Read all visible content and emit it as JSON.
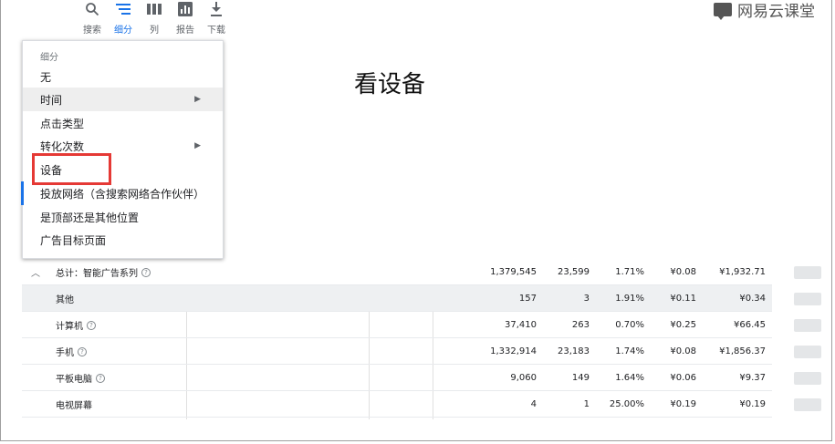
{
  "toolbar": {
    "items": [
      {
        "label": "搜索",
        "icon": "search-icon"
      },
      {
        "label": "细分",
        "icon": "segment-icon"
      },
      {
        "label": "列",
        "icon": "columns-icon"
      },
      {
        "label": "报告",
        "icon": "report-icon"
      },
      {
        "label": "下载",
        "icon": "download-icon"
      }
    ],
    "active_color": "#1a73e8"
  },
  "watermark": {
    "text": "网易云课堂"
  },
  "annotation": {
    "text": "看设备"
  },
  "menu": {
    "header": "细分",
    "items": [
      {
        "label": "无"
      },
      {
        "label": "时间",
        "has_submenu": true
      },
      {
        "label": "点击类型"
      },
      {
        "label": "转化次数",
        "has_submenu": true
      },
      {
        "label": "设备"
      },
      {
        "label": "投放网络（含搜索网络合作伙伴）"
      },
      {
        "label": "是顶部还是其他位置"
      },
      {
        "label": "广告目标页面"
      }
    ],
    "highlight_color": "#e53935"
  },
  "table": {
    "total": {
      "name": "总计：智能广告系列",
      "values": [
        "1,379,545",
        "23,599",
        "1.71%",
        "¥0.08",
        "¥1,932.71"
      ]
    },
    "rows": [
      {
        "name": "其他",
        "values": [
          "157",
          "3",
          "1.91%",
          "¥0.11",
          "¥0.34"
        ]
      },
      {
        "name": "计算机",
        "values": [
          "37,410",
          "263",
          "0.70%",
          "¥0.25",
          "¥66.45"
        ]
      },
      {
        "name": "手机",
        "values": [
          "1,332,914",
          "23,183",
          "1.74%",
          "¥0.08",
          "¥1,856.37"
        ]
      },
      {
        "name": "平板电脑",
        "values": [
          "9,060",
          "149",
          "1.64%",
          "¥0.06",
          "¥9.37"
        ]
      },
      {
        "name": "电视屏幕",
        "values": [
          "4",
          "1",
          "25.00%",
          "¥0.19",
          "¥0.19"
        ]
      }
    ]
  }
}
